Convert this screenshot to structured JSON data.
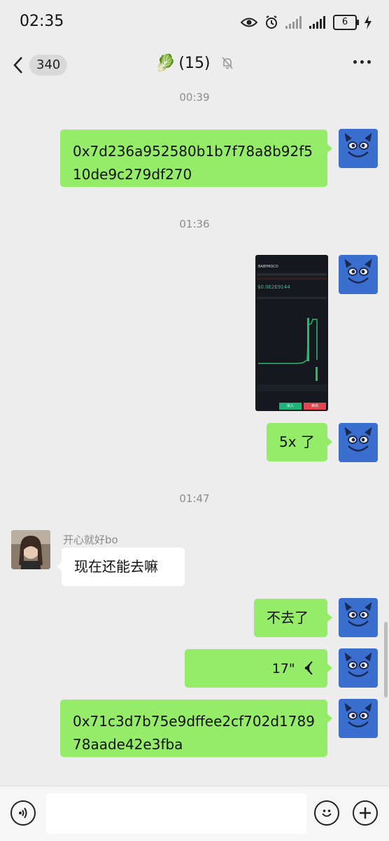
{
  "status_bar": {
    "time": "02:35",
    "battery": "6"
  },
  "header": {
    "unread_count": "340",
    "title": "(15)",
    "title_emoji": "🥬"
  },
  "messages": [
    {
      "type": "time",
      "text": "00:39"
    },
    {
      "type": "text",
      "side": "right",
      "text": "0x7d236a952580b1b7f78a8b92f510de9c279df270"
    },
    {
      "type": "time",
      "text": "01:36"
    },
    {
      "type": "image",
      "side": "right",
      "header": "BABYMOCO",
      "price": "$0.0E2E9144",
      "buy": "买入",
      "sell": "卖出"
    },
    {
      "type": "text",
      "side": "right",
      "text": "5x 了"
    },
    {
      "type": "time",
      "text": "01:47"
    },
    {
      "type": "text",
      "side": "left",
      "sender": "开心就好bo",
      "text": "现在还能去嘛"
    },
    {
      "type": "text",
      "side": "right",
      "text": "不去了"
    },
    {
      "type": "voice",
      "side": "right",
      "duration": "17\""
    },
    {
      "type": "text",
      "side": "right",
      "text": "0x71c3d7b75e9dffee2cf702d178978aade42e3fba"
    }
  ],
  "colors": {
    "bubble_self": "#95ec69",
    "bubble_other": "#ffffff",
    "background": "#ededed"
  }
}
